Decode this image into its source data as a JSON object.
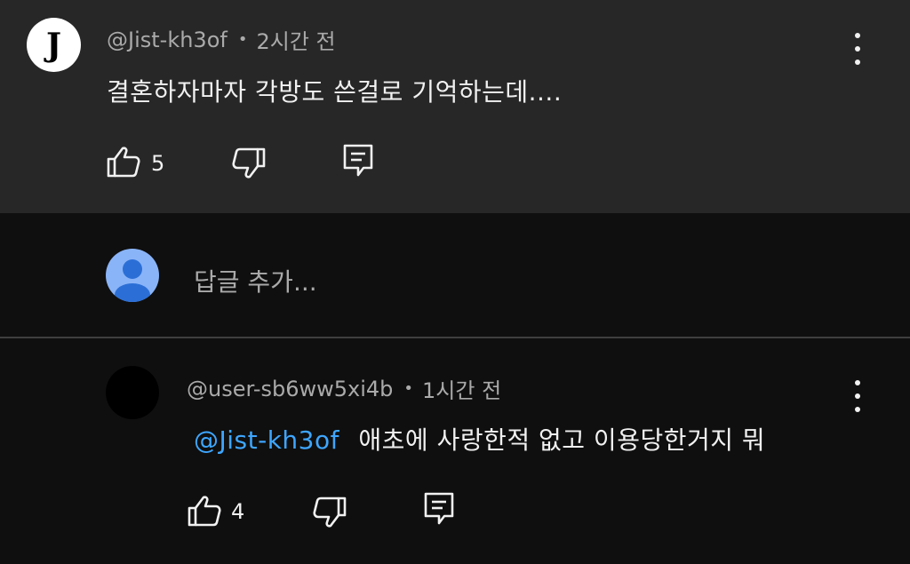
{
  "comment": {
    "avatar_letter": "J",
    "author": "@Jist-kh3of",
    "separator": "•",
    "time": "2시간 전",
    "text": "결혼하자마자 각방도 쓴걸로 기억하는데....",
    "like_count": "5"
  },
  "reply_box": {
    "placeholder": "답글 추가..."
  },
  "reply": {
    "author": "@user-sb6ww5xi4b",
    "separator": "•",
    "time": "1시간 전",
    "mention": "@Jist-kh3of",
    "text": "애초에 사랑한적 없고 이용당한거지 뭐",
    "like_count": "4"
  },
  "icons": {
    "like": "thumbs-up-icon",
    "dislike": "thumbs-down-icon",
    "reply": "reply-icon",
    "more": "more-vert-icon"
  },
  "colors": {
    "background": "#0f0f0f",
    "comment_highlight": "#272727",
    "mention": "#3ea6ff",
    "meta_text": "#aaaaaa",
    "default_avatar": "#8ab4f8"
  }
}
